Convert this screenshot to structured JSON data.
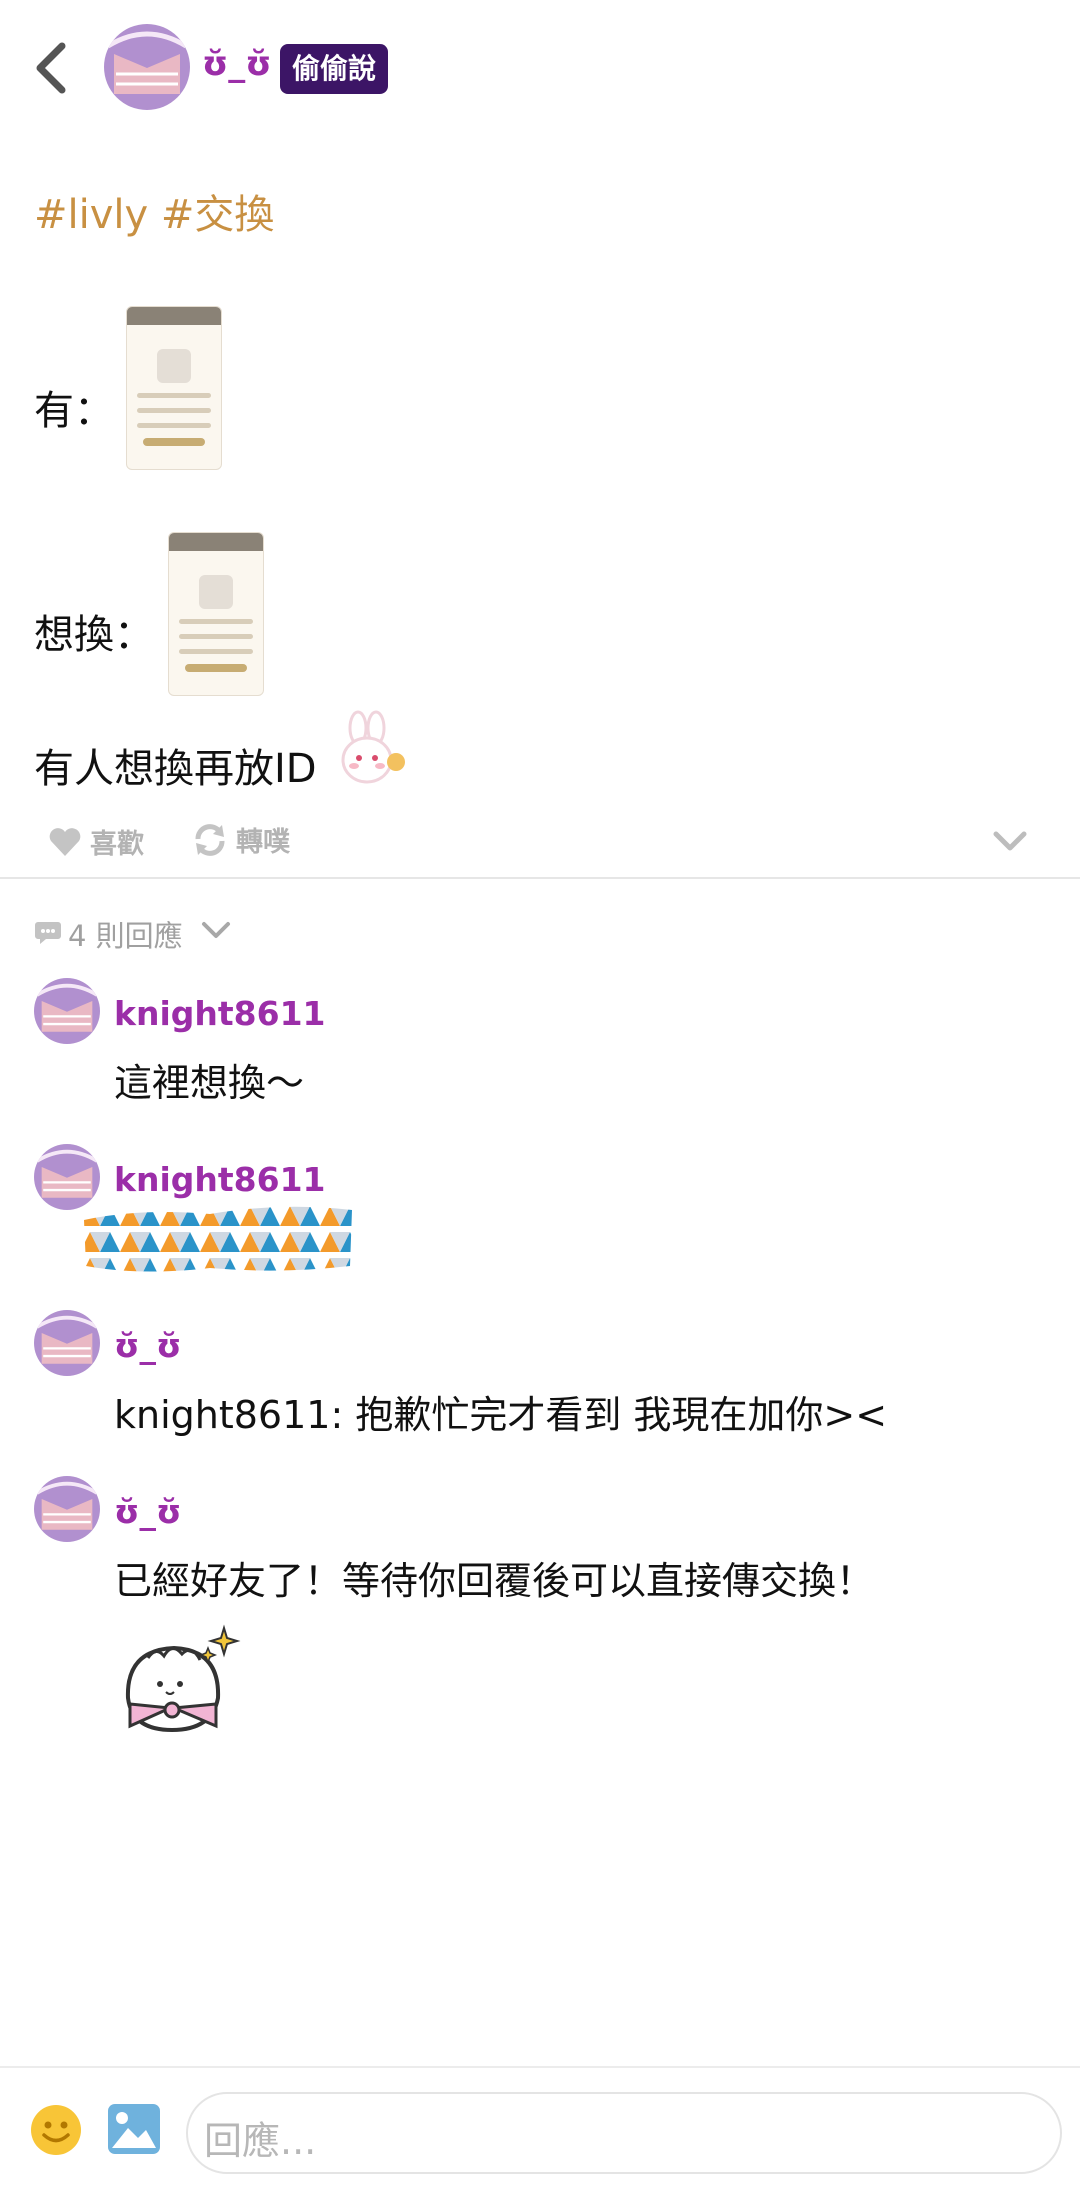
{
  "header": {
    "back_icon": "chevron-left-icon",
    "poster_name": "ʊ̆_ʊ̆",
    "badge": "偷偷說"
  },
  "post": {
    "tags": "#livly #交換",
    "have_label": "有：",
    "want_label": "想換：",
    "last_line": "有人想換再放ID",
    "sticker_icon": "bunny-sticker-icon"
  },
  "actions": {
    "like_label": "喜歡",
    "replurk_label": "轉噗",
    "more_icon": "chevron-down-icon"
  },
  "replies": {
    "count_label": "4 則回應",
    "items": [
      {
        "name": "knight8611",
        "text": "這裡想換～"
      },
      {
        "name": "knight8611",
        "text": ""
      },
      {
        "name": "ʊ̆_ʊ̆",
        "text": "knight8611: 抱歉忙完才看到 我現在加你><"
      },
      {
        "name": "ʊ̆_ʊ̆",
        "text": "已經好友了！等待你回覆後可以直接傳交換！"
      }
    ]
  },
  "composer": {
    "emoji_icon": "smiley-icon",
    "image_icon": "image-icon",
    "placeholder": "回應..."
  },
  "colors": {
    "accent_purple": "#9b2ea8",
    "badge_bg": "#3c1566",
    "tag_color": "#c89042"
  }
}
